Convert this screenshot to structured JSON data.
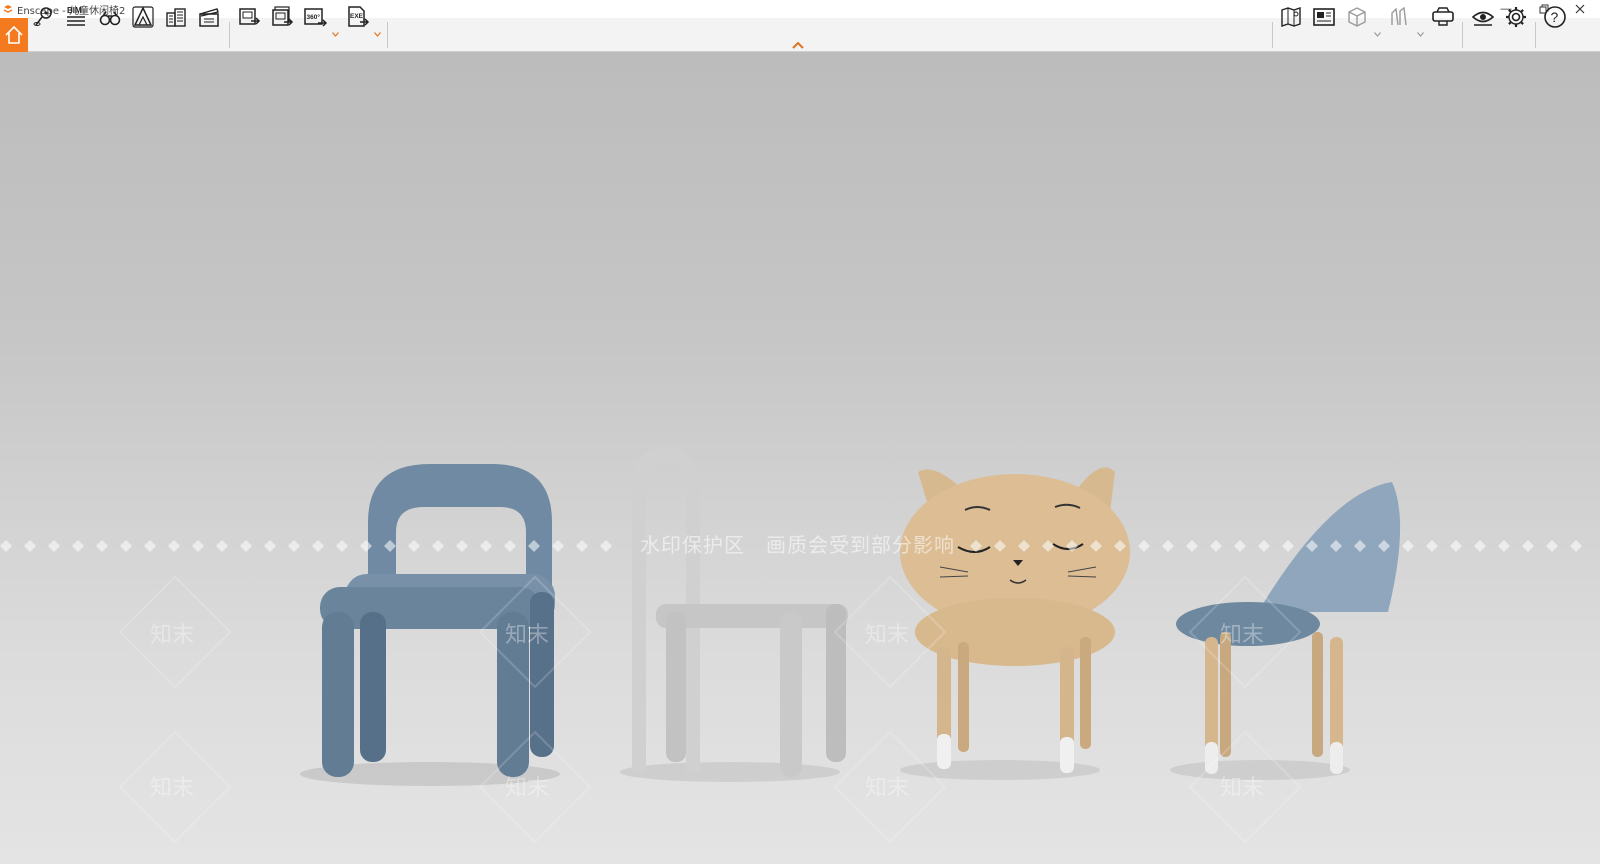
{
  "window": {
    "title": "Enscape - 儿童休闲椅2"
  },
  "toolbar": {
    "left_buttons": [
      "home-icon",
      "location-pin-icon",
      "bim-icon",
      "binoculars-icon",
      "terrain-icon",
      "buildings-icon",
      "clapperboard-icon",
      "screenshot-icon",
      "batch-render-icon",
      "panorama-icon",
      "export-exe-icon"
    ],
    "bim_label": "BIM",
    "pano_label": "360°",
    "exe_label": "EXE",
    "right_buttons": [
      "map-icon",
      "gallery-icon",
      "cube-icon",
      "assets-icon",
      "vr-headset-icon",
      "eye-icon",
      "gear-icon",
      "help-icon"
    ],
    "help_label": "?"
  },
  "viewport": {
    "watermark_text": "水印保护区　画质会受到部分影响",
    "watermark_logo": "知末"
  },
  "colors": {
    "accent": "#f47a20",
    "toolbar": "#f3f3f3",
    "chair_blue": "#6e88a0",
    "chair_white": "#cfcfcf",
    "cat_tan": "#d8bb92"
  }
}
